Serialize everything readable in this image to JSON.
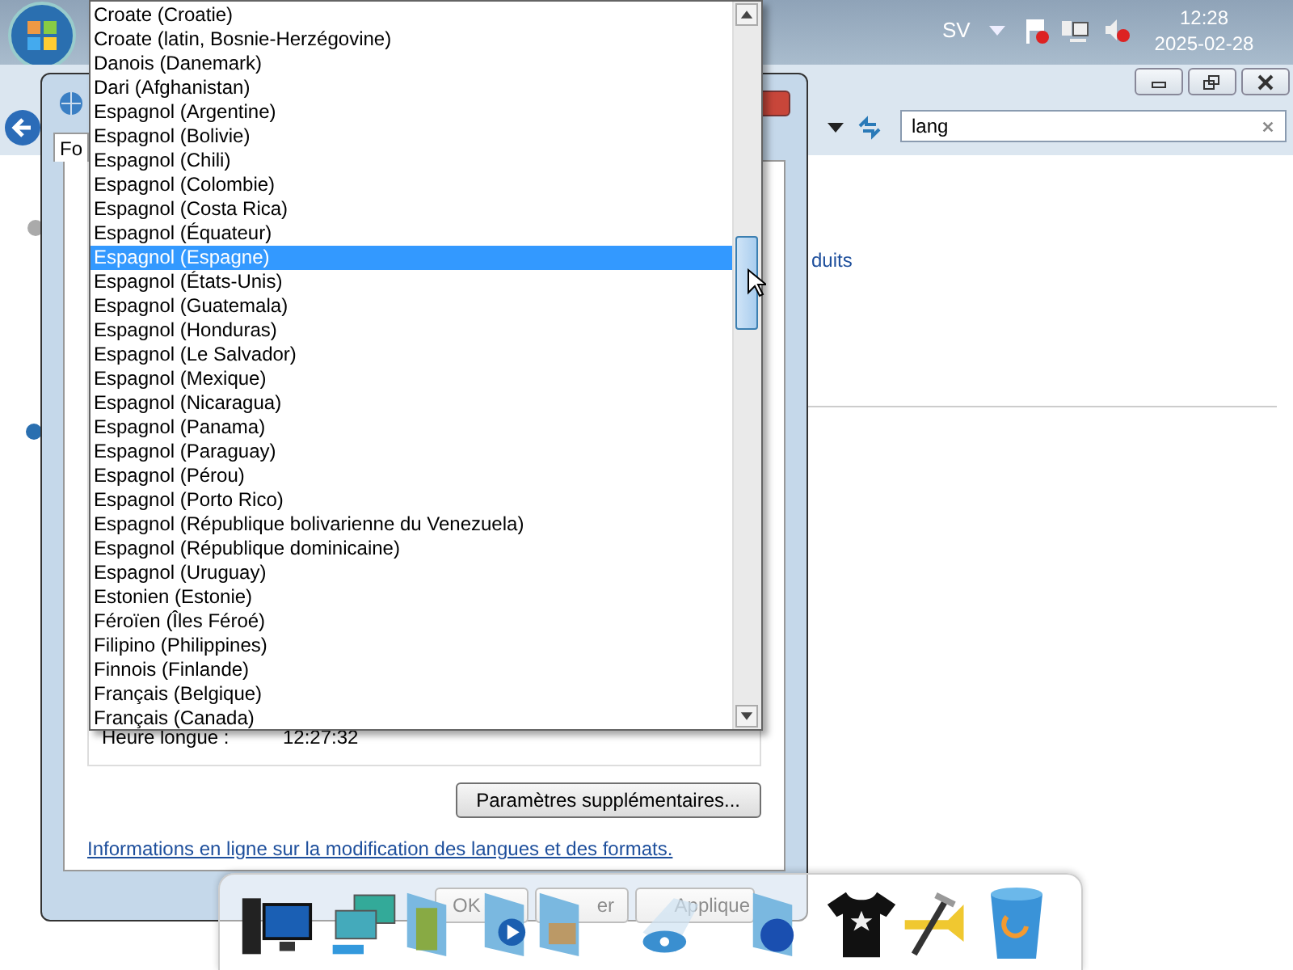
{
  "taskbar": {
    "language": "SV",
    "time": "12:28",
    "date": "2025-02-28"
  },
  "explorer": {
    "search": {
      "value": "lang"
    },
    "content_text": "duits"
  },
  "dialog": {
    "tab_label": "Fo",
    "long_time_label": "Heure longue :",
    "long_time_value": "12:27:32",
    "more_settings_button": "Paramètres supplémentaires...",
    "help_link": "Informations en ligne sur la modification des langues et des formats.",
    "buttons": [
      "OK",
      "er",
      "Applique"
    ]
  },
  "dropdown": {
    "items": [
      {
        "label": "Croate (Croatie)",
        "selected": false
      },
      {
        "label": "Croate (latin, Bosnie-Herzégovine)",
        "selected": false
      },
      {
        "label": "Danois (Danemark)",
        "selected": false
      },
      {
        "label": "Dari (Afghanistan)",
        "selected": false
      },
      {
        "label": "Espagnol (Argentine)",
        "selected": false
      },
      {
        "label": "Espagnol (Bolivie)",
        "selected": false
      },
      {
        "label": "Espagnol (Chili)",
        "selected": false
      },
      {
        "label": "Espagnol (Colombie)",
        "selected": false
      },
      {
        "label": "Espagnol (Costa Rica)",
        "selected": false
      },
      {
        "label": "Espagnol (Équateur)",
        "selected": false
      },
      {
        "label": "Espagnol (Espagne)",
        "selected": true
      },
      {
        "label": "Espagnol (États-Unis)",
        "selected": false
      },
      {
        "label": "Espagnol (Guatemala)",
        "selected": false
      },
      {
        "label": "Espagnol (Honduras)",
        "selected": false
      },
      {
        "label": "Espagnol (Le Salvador)",
        "selected": false
      },
      {
        "label": "Espagnol (Mexique)",
        "selected": false
      },
      {
        "label": "Espagnol (Nicaragua)",
        "selected": false
      },
      {
        "label": "Espagnol (Panama)",
        "selected": false
      },
      {
        "label": "Espagnol (Paraguay)",
        "selected": false
      },
      {
        "label": "Espagnol (Pérou)",
        "selected": false
      },
      {
        "label": "Espagnol (Porto Rico)",
        "selected": false
      },
      {
        "label": "Espagnol (République bolivarienne du Venezuela)",
        "selected": false
      },
      {
        "label": "Espagnol (République dominicaine)",
        "selected": false
      },
      {
        "label": "Espagnol (Uruguay)",
        "selected": false
      },
      {
        "label": "Estonien (Estonie)",
        "selected": false
      },
      {
        "label": "Féroïen (Îles Féroé)",
        "selected": false
      },
      {
        "label": "Filipino (Philippines)",
        "selected": false
      },
      {
        "label": "Finnois (Finlande)",
        "selected": false
      },
      {
        "label": "Français (Belgique)",
        "selected": false
      },
      {
        "label": "Français (Canada)",
        "selected": false
      }
    ]
  }
}
